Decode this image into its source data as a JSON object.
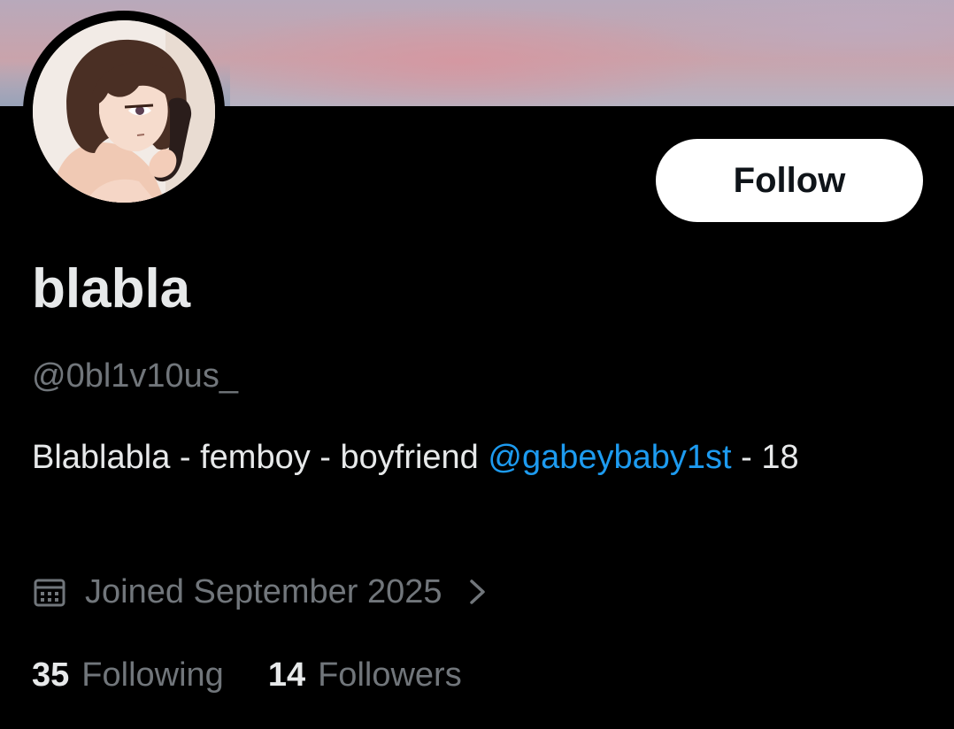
{
  "profile": {
    "display_name": "blabla",
    "handle": "@0bl1v10us_",
    "bio": {
      "text_before": "Blablabla - femboy - boyfriend ",
      "mention": "@gabeybaby1st",
      "text_after": " - 18"
    },
    "joined": "Joined September 2025",
    "following": {
      "count": "35",
      "label": "Following"
    },
    "followers": {
      "count": "14",
      "label": "Followers"
    }
  },
  "actions": {
    "follow_label": "Follow"
  },
  "icons": {
    "joined_icon": "calendar-icon",
    "joined_chevron": "chevron-right-icon"
  },
  "colors": {
    "background": "#000000",
    "text_primary": "#e7e9ea",
    "text_secondary": "#71767b",
    "link": "#1d9bf0",
    "follow_button_bg": "#ffffff",
    "follow_button_text": "#0f1419"
  }
}
